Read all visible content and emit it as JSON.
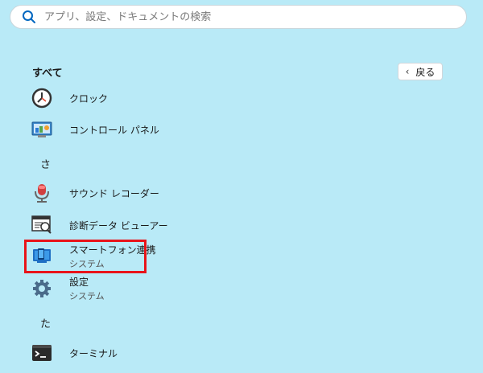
{
  "search": {
    "placeholder": "アプリ、設定、ドキュメントの検索",
    "icon": "search-icon"
  },
  "section_label": "すべて",
  "back_button": {
    "label": "戻る",
    "icon": "chevron-left-icon"
  },
  "letters": {
    "sa": "さ",
    "ta": "た"
  },
  "apps": [
    {
      "name": "クロック",
      "icon": "clock-icon"
    },
    {
      "name": "コントロール パネル",
      "icon": "control-panel-icon"
    },
    {
      "name": "サウンド レコーダー",
      "icon": "microphone-icon"
    },
    {
      "name": "診断データ ビューアー",
      "icon": "diagnostic-viewer-icon"
    },
    {
      "name": "スマートフォン連携",
      "subtitle": "システム",
      "icon": "phone-link-icon"
    },
    {
      "name": "設定",
      "subtitle": "システム",
      "icon": "gear-icon"
    },
    {
      "name": "ターミナル",
      "icon": "terminal-icon"
    }
  ],
  "colors": {
    "background": "#b9eaf7",
    "highlight": "#e8141a",
    "accent": "#0067c0"
  }
}
